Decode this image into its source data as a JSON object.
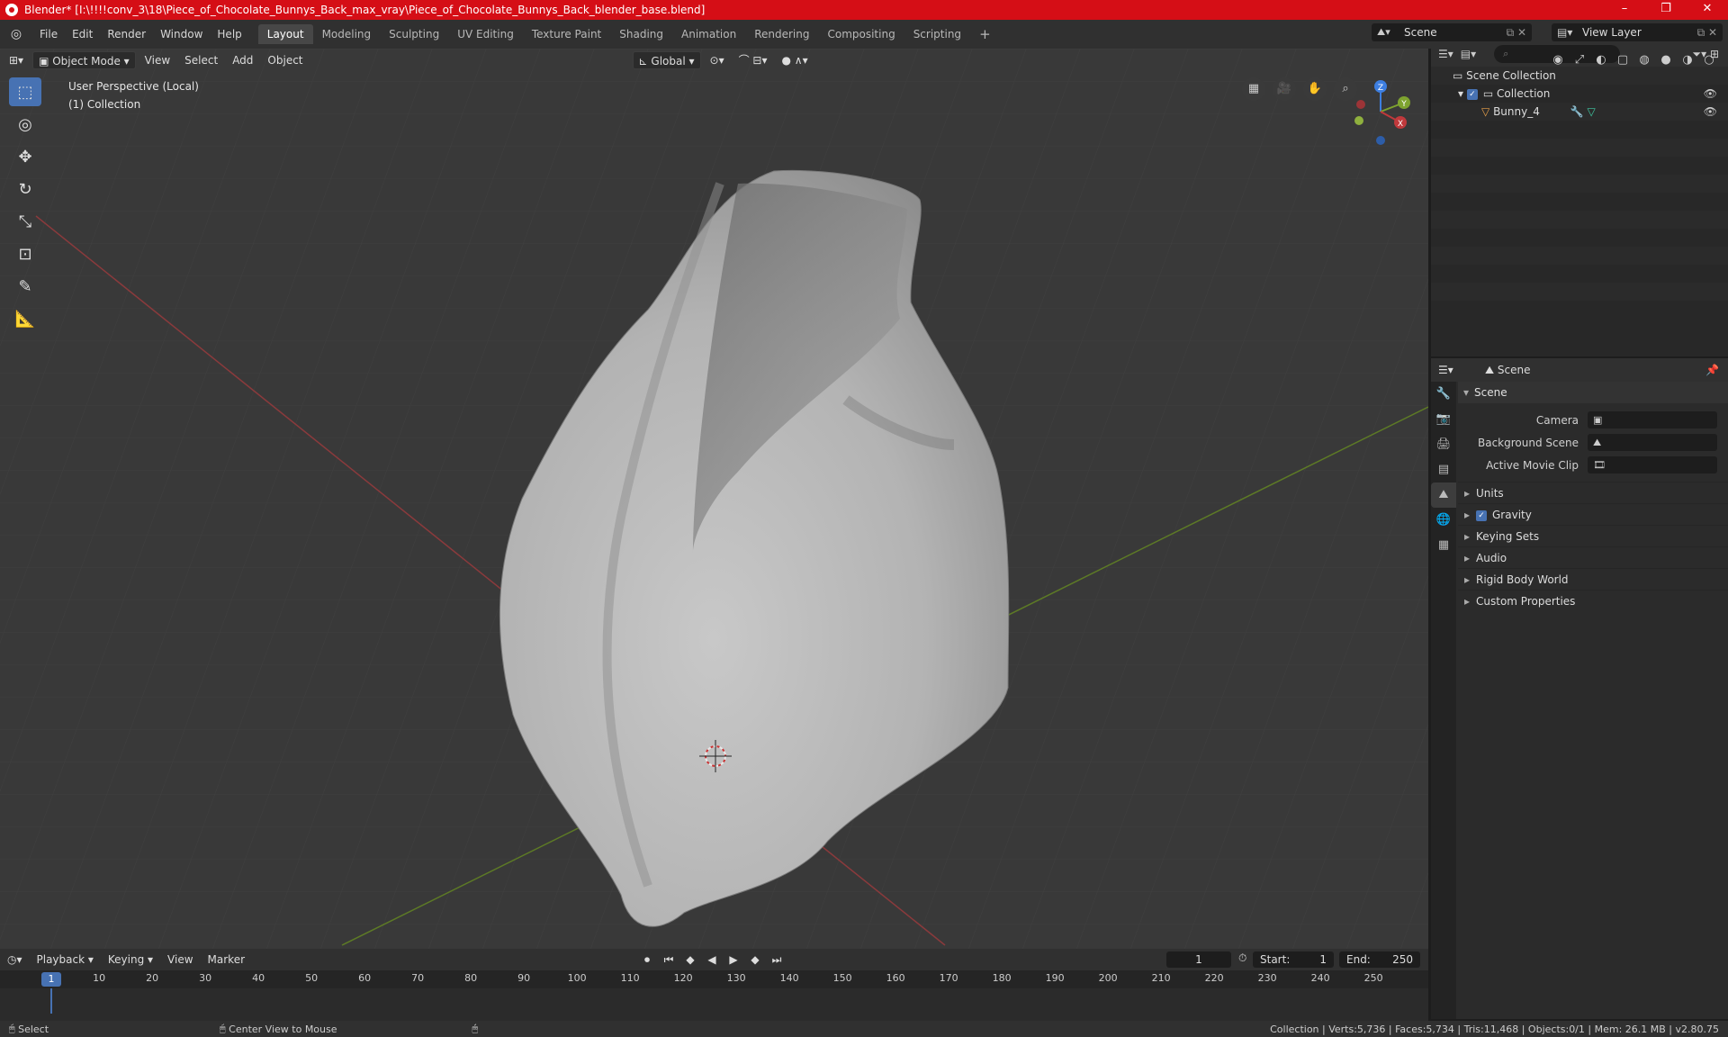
{
  "titlebar": {
    "title": "Blender* [I:\\!!!!conv_3\\18\\Piece_of_Chocolate_Bunnys_Back_max_vray\\Piece_of_Chocolate_Bunnys_Back_blender_base.blend]"
  },
  "menu": [
    "File",
    "Edit",
    "Render",
    "Window",
    "Help"
  ],
  "workspaces": [
    "Layout",
    "Modeling",
    "Sculpting",
    "UV Editing",
    "Texture Paint",
    "Shading",
    "Animation",
    "Rendering",
    "Compositing",
    "Scripting"
  ],
  "scene_name": "Scene",
  "view_layer": "View Layer",
  "viewport": {
    "mode": "Object Mode",
    "menus": [
      "View",
      "Select",
      "Add",
      "Object"
    ],
    "transform_orientation": "Global",
    "overlay_line1": "User Perspective (Local)",
    "overlay_line2": "(1) Collection"
  },
  "gizmo": {
    "z": "Z",
    "y": "Y",
    "x": "X"
  },
  "outliner": {
    "scene_collection": "Scene Collection",
    "collection": "Collection",
    "object": "Bunny_4"
  },
  "properties": {
    "header": "Scene",
    "panel": "Scene",
    "camera_label": "Camera",
    "bg_scene_label": "Background Scene",
    "movie_clip_label": "Active Movie Clip",
    "subpanels": [
      "Units",
      "Gravity",
      "Keying Sets",
      "Audio",
      "Rigid Body World",
      "Custom Properties"
    ]
  },
  "timeline": {
    "menus": [
      "Playback",
      "Keying",
      "View",
      "Marker"
    ],
    "current_frame": "1",
    "start_label": "Start:",
    "start": "1",
    "end_label": "End:",
    "end": "250",
    "ticks": [
      "1",
      "10",
      "20",
      "30",
      "40",
      "50",
      "60",
      "70",
      "80",
      "90",
      "100",
      "110",
      "120",
      "130",
      "140",
      "150",
      "160",
      "170",
      "180",
      "190",
      "200",
      "210",
      "220",
      "230",
      "240",
      "250"
    ]
  },
  "status": {
    "select": "Select",
    "center": "Center View to Mouse",
    "stats": "Collection | Verts:5,736 | Faces:5,734 | Tris:11,468 | Objects:0/1 | Mem: 26.1 MB | v2.80.75"
  },
  "colors": {
    "accent": "#4772b3",
    "titlebar": "#d50e16",
    "x_axis": "#c0393c",
    "y_axis": "#7ea32f",
    "z_axis": "#3d7ee0"
  }
}
